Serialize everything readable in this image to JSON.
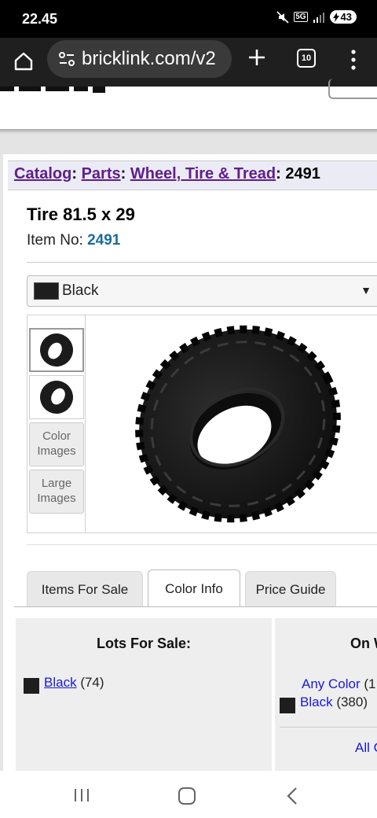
{
  "status_bar": {
    "time": "22.45",
    "network": "5G",
    "battery": "43"
  },
  "browser": {
    "url": "bricklink.com/v2",
    "tab_count": "10"
  },
  "breadcrumb": {
    "catalog": "Catalog",
    "parts": "Parts",
    "category": "Wheel, Tire & Tread",
    "item": "2491",
    "sep": ":"
  },
  "item": {
    "title": "Tire 81.5 x 29",
    "number_label": "Item No: ",
    "number": "2491"
  },
  "color_select": {
    "selected": "Black",
    "swatch_color": "#1e1e1e"
  },
  "gallery": {
    "thumb_buttons": [
      "Color Images",
      "Large Images"
    ]
  },
  "tabs": [
    {
      "label": "Items For Sale",
      "active": false
    },
    {
      "label": "Color Info",
      "active": true
    },
    {
      "label": "Price Guide",
      "active": false
    }
  ],
  "lots_for_sale": {
    "title": "Lots For Sale:",
    "color": "Black",
    "count": "(74)"
  },
  "on_wanted": {
    "title": "On W",
    "any_color": "Any Color",
    "any_count": "(1",
    "black": "Black",
    "black_count": "(380)",
    "all": "All C"
  }
}
